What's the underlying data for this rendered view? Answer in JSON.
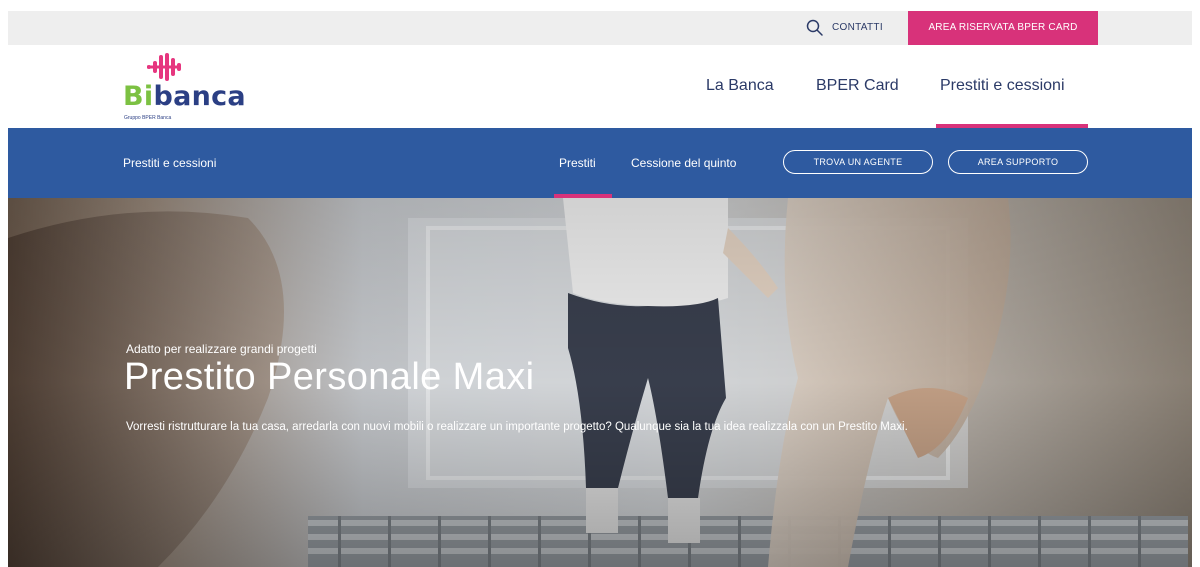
{
  "utility_bar": {
    "search_icon": "search-icon",
    "contact_label": "CONTATTI",
    "reserved_area_label": "AREA RISERVATA BPER CARD",
    "reserved_area_color": "#d8327a"
  },
  "header": {
    "logo": {
      "brand_first": "Bi",
      "brand_rest": "banca",
      "subtitle": "Gruppo BPER Banca",
      "wave_color": "#e6367f",
      "bi_color": "#7cc142",
      "banca_color": "#2b3f84"
    },
    "nav": [
      {
        "label": "La Banca"
      },
      {
        "label": "BPER Card"
      },
      {
        "label": "Prestiti e cessioni",
        "active": true
      }
    ]
  },
  "sub_nav": {
    "title": "Prestiti e cessioni",
    "links": [
      {
        "label": "Prestiti",
        "active": true
      },
      {
        "label": "Cessione del quinto"
      }
    ],
    "buttons": [
      {
        "label": "TROVA UN AGENTE"
      },
      {
        "label": "AREA SUPPORTO"
      }
    ],
    "background_color": "#2e5aa0"
  },
  "hero": {
    "eyebrow": "Adatto per realizzare grandi progetti",
    "title": "Prestito Personale Maxi",
    "description": "Vorresti ristrutturare la tua casa, arredarla con nuovi mobili o realizzare un importante progetto? Qualunque sia la tua idea realizzala con un Prestito Maxi."
  }
}
